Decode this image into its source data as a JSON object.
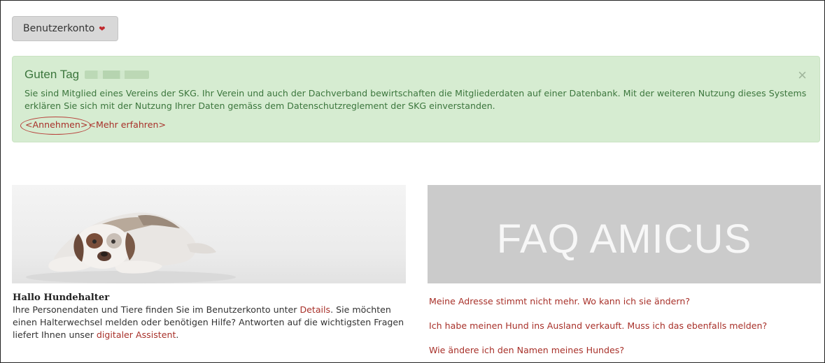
{
  "account": {
    "label": "Benutzerkonto",
    "chevron_icon": "chevron-down-icon",
    "chevron_glyph": "❤",
    "chevron_color": "#c0282d"
  },
  "alert": {
    "greeting": "Guten Tag",
    "close_glyph": "×",
    "message": "Sie sind Mitglied eines Vereins der SKG. Ihr Verein und auch der Dachverband bewirtschaften die Mitgliederdaten auf einer Datenbank. Mit der weiteren Nutzung dieses Systems erklären Sie sich mit der Nutzung Ihrer Daten gemäss dem Datenschutzreglement der SKG einverstanden.",
    "accept_link": "<Annehmen>",
    "more_link": "<Mehr erfahren>",
    "background": "#d6ecd1",
    "text_color": "#3c763d"
  },
  "left": {
    "title": "Hallo Hundehalter",
    "text_1": "Ihre Personendaten und Tiere finden Sie im Benutzerkonto unter ",
    "details_link": "Details",
    "text_2": ". Sie möchten einen Halterwechsel melden oder benötigen Hilfe? Antworten auf die wichtigsten Fragen liefert Ihnen unser ",
    "assistant_link": "digitaler Assistent",
    "text_3": "."
  },
  "faq": {
    "banner_title": "FAQ AMICUS",
    "links": [
      "Meine Adresse stimmt nicht mehr. Wo kann ich sie ändern?",
      "Ich habe meinen Hund ins Ausland verkauft. Muss ich das ebenfalls melden?",
      "Wie ändere ich den Namen meines Hundes?"
    ]
  },
  "colors": {
    "link": "#a8312a",
    "faq_banner": "#cbcbcb"
  }
}
